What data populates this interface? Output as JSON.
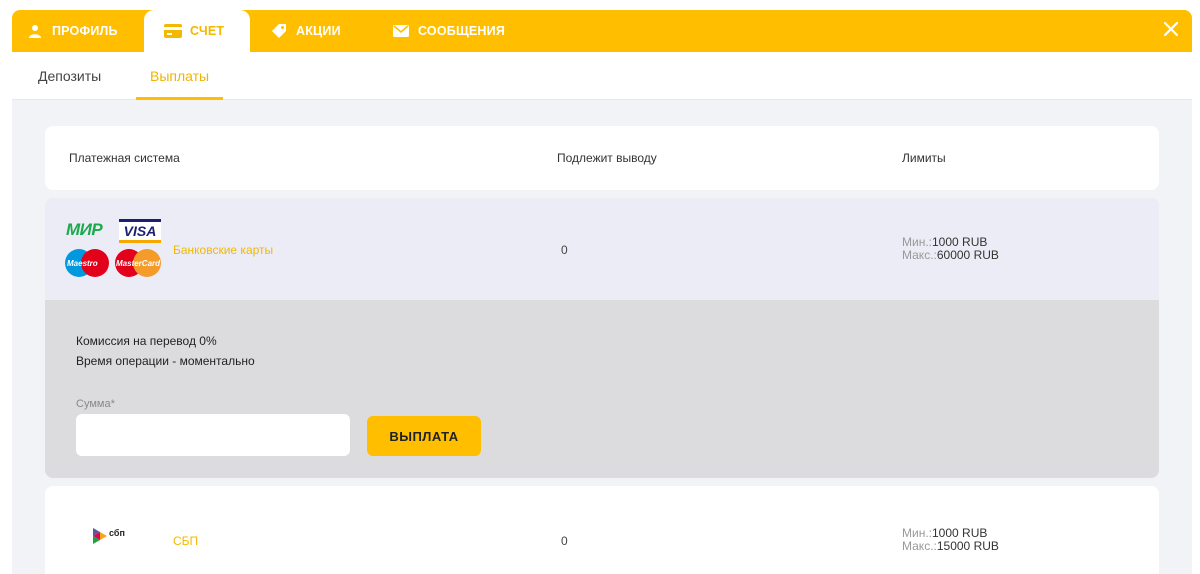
{
  "topbar": {
    "tabs": [
      {
        "label": "ПРОФИЛЬ",
        "icon": "user-icon"
      },
      {
        "label": "СЧЕТ",
        "icon": "wallet-icon"
      },
      {
        "label": "АКЦИИ",
        "icon": "tag-icon"
      },
      {
        "label": "СООБЩЕНИЯ",
        "icon": "envelope-icon"
      }
    ],
    "active_tab": "СЧЕТ",
    "close_icon": "close-icon"
  },
  "subtabs": {
    "items": [
      {
        "label": "Депозиты"
      },
      {
        "label": "Выплаты"
      }
    ],
    "active": "Выплаты"
  },
  "table": {
    "headers": [
      "Платежная система",
      "Подлежит выводу",
      "Лимиты"
    ],
    "rows": [
      {
        "name": "Банковские карты",
        "logos": {
          "mir": "МИР",
          "visa": "VISA",
          "maestro": "Maestro",
          "mastercard": "MasterCard"
        },
        "amount": "0",
        "min_label": "Мин.:",
        "min_value": "1000 RUB",
        "max_label": "Макс.:",
        "max_value": "60000 RUB"
      },
      {
        "name": "СБП",
        "logos": {
          "sbp": "сбп"
        },
        "amount": "0",
        "min_label": "Мин.:",
        "min_value": "1000 RUB",
        "max_label": "Макс.:",
        "max_value": "15000 RUB"
      }
    ]
  },
  "expanded": {
    "commission": "Комиссия на перевод 0%",
    "operation_time": "Время операции - моментально",
    "amount_label": "Сумма*",
    "amount_value": "",
    "payout_button": "ВЫПЛАТА"
  },
  "colors": {
    "accent": "#ffbf00",
    "accent_text": "#f3b800",
    "row_highlight": "#ececf6",
    "expanded_bg": "#dcdcde"
  }
}
